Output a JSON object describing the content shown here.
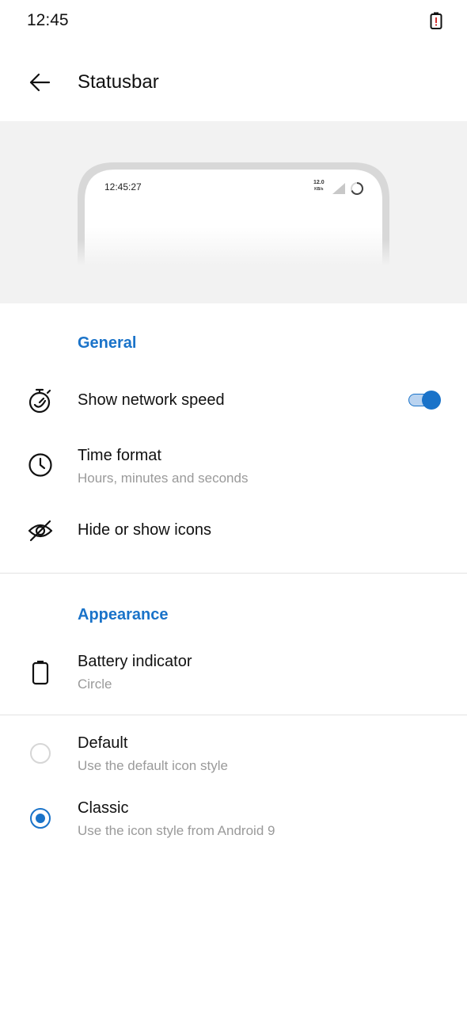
{
  "status_bar": {
    "time": "12:45",
    "battery_icon": "battery-alert-icon"
  },
  "app_bar": {
    "back_icon": "arrow-back-icon",
    "title": "Statusbar"
  },
  "preview": {
    "time": "12:45:27",
    "speed_value": "12.0",
    "speed_unit": "KB/s"
  },
  "general": {
    "header": "General",
    "network_speed": {
      "title": "Show network speed",
      "icon": "stopwatch-icon",
      "enabled": true
    },
    "time_format": {
      "title": "Time format",
      "subtitle": "Hours, minutes and seconds",
      "icon": "clock-icon"
    },
    "hide_icons": {
      "title": "Hide or show icons",
      "icon": "eye-off-icon"
    }
  },
  "appearance": {
    "header": "Appearance",
    "battery": {
      "title": "Battery indicator",
      "subtitle": "Circle",
      "icon": "battery-icon"
    }
  },
  "icon_style": {
    "options": [
      {
        "title": "Default",
        "subtitle": "Use the default icon style",
        "selected": false
      },
      {
        "title": "Classic",
        "subtitle": "Use the icon style from Android 9",
        "selected": true
      }
    ]
  },
  "colors": {
    "accent": "#1a73c9",
    "preview_bg": "#f2f2f2"
  }
}
